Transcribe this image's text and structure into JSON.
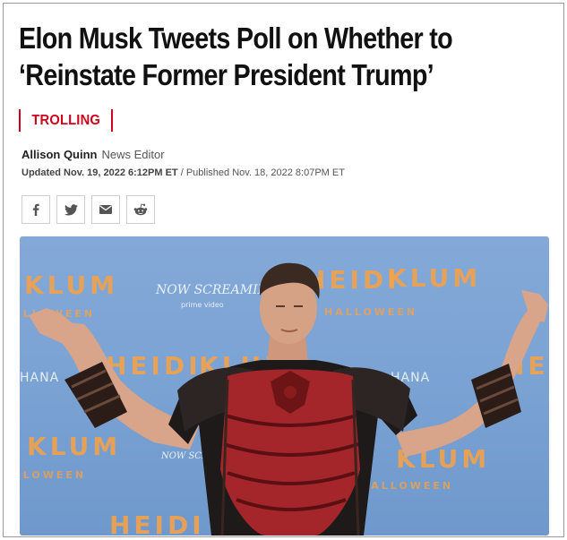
{
  "article": {
    "headline": "Elon Musk Tweets Poll on Whether to ‘Reinstate Former President Trump’",
    "kicker": "TROLLING",
    "author": "Allison Quinn",
    "author_role": "News Editor",
    "updated": "Updated Nov. 19, 2022 6:12PM ET",
    "published": "Published Nov. 18, 2022 8:07PM ET"
  },
  "share": [
    {
      "icon": "facebook-icon"
    },
    {
      "icon": "twitter-icon"
    },
    {
      "icon": "email-icon"
    },
    {
      "icon": "reddit-icon"
    }
  ],
  "photo": {
    "backdrop_text": [
      "KLUM",
      "HEIDI",
      "KLUM",
      "HEIDI",
      "KLUM",
      "HEIDI",
      "KLUM",
      "KLUM",
      "HEIDI"
    ],
    "backdrop_sub": [
      "HALLOWEEN",
      "HALLOWEEN",
      "HALLOWEEN",
      "HALLOWEEN"
    ],
    "backdrop_logo": [
      "NOW SCREAMING",
      "NOW SCREAMING"
    ],
    "backdrop_small": [
      "HANA",
      "HANA",
      "prime video"
    ]
  },
  "colors": {
    "accent": "#d0021b",
    "backdrop_blue": "#7aa2d3",
    "backdrop_orange": "#f2a24b",
    "armor_red": "#a5262a"
  }
}
